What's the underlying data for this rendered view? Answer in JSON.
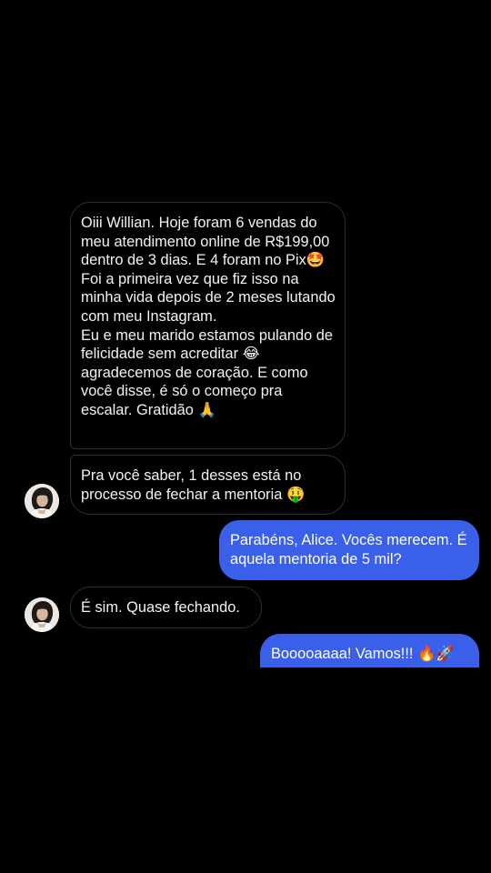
{
  "conversation": {
    "messages": [
      {
        "sender": "contact",
        "text": "Oiii Willian. Hoje foram 6 vendas do meu atendimento online de R$199,00 dentro de 3 dias. E 4 foram no Pix🤩\nFoi a primeira vez que fiz isso na minha vida depois de 2 meses lutando com meu Instagram.\nEu e meu marido estamos pulando de felicidade sem acreditar 😂 agradecemos de coração. E como você disse, é só o começo pra escalar. Gratidão 🙏"
      },
      {
        "sender": "contact",
        "text": "Pra você saber, 1 desses está no processo de fechar a mentoria 🤑"
      },
      {
        "sender": "me",
        "text": "Parabéns, Alice. Vocês merecem. É aquela mentoria de 5 mil?"
      },
      {
        "sender": "contact",
        "text": "É sim. Quase fechando."
      },
      {
        "sender": "me",
        "text": "Booooaaaa! Vamos!!! 🔥🚀"
      }
    ]
  },
  "colors": {
    "background": "#000000",
    "sent_bubble": "#3a5fe8",
    "received_border": "#2e2e2e",
    "text": "#f2f2f2"
  },
  "icons": {
    "contact_avatar": "profile-photo-avatar"
  }
}
